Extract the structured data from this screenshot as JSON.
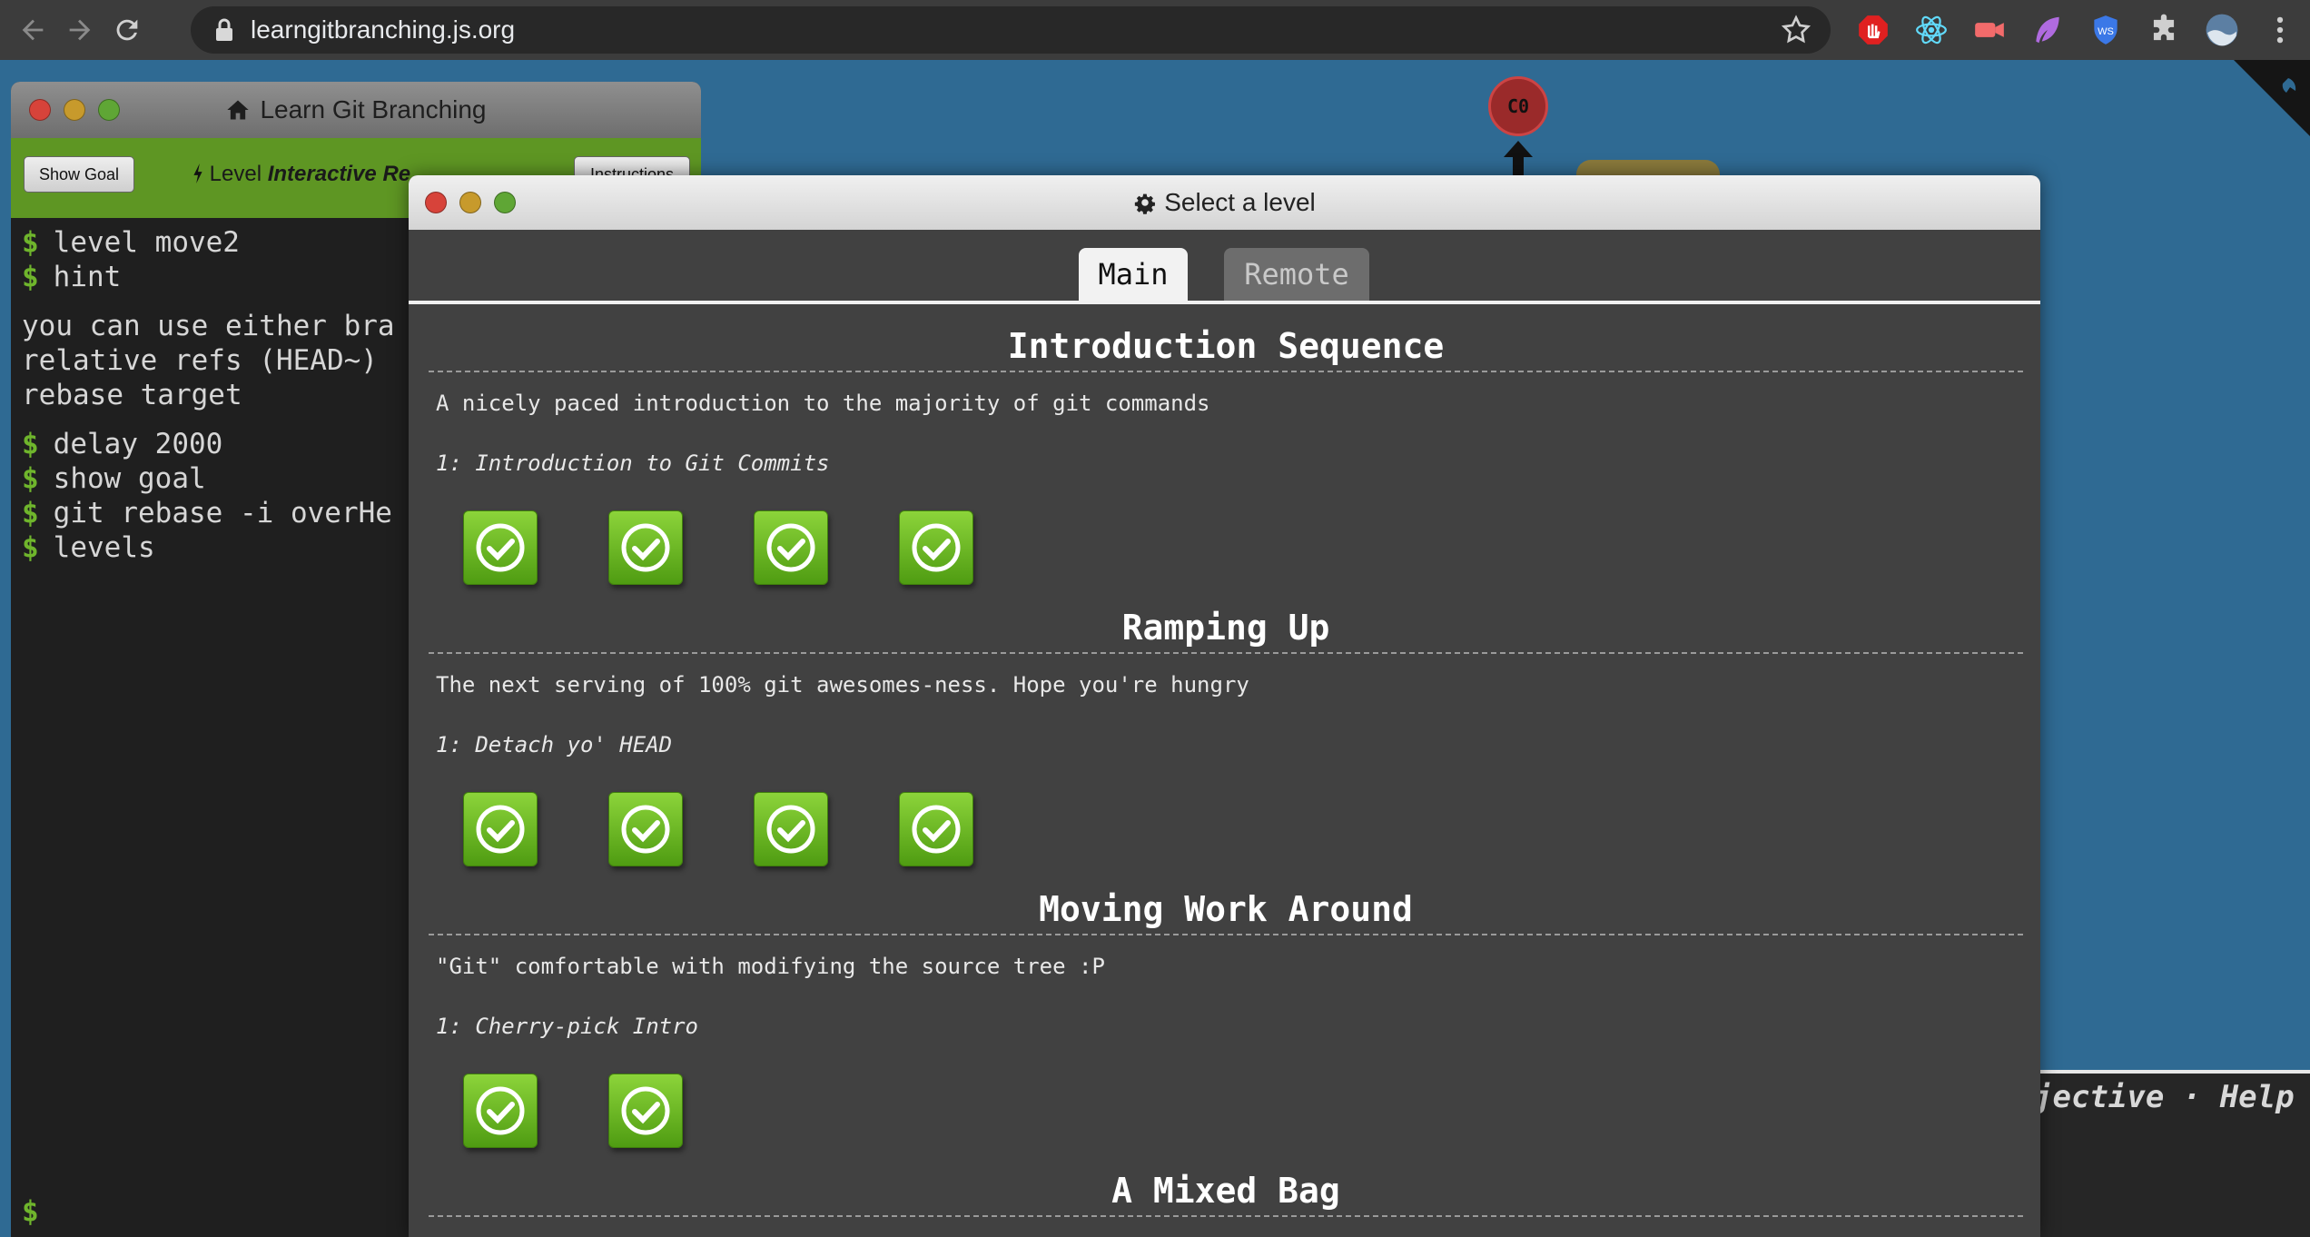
{
  "browser": {
    "url": "learngitbranching.js.org",
    "nav": {
      "back_icon": "back-arrow-icon",
      "forward_icon": "forward-arrow-icon",
      "reload_icon": "reload-icon"
    },
    "extensions": [
      "adblock-icon",
      "react-devtools-icon",
      "video-extension-icon",
      "feather-icon",
      "shield-icon",
      "puzzle-icon",
      "profile-avatar",
      "more-menu-icon"
    ]
  },
  "graph": {
    "commit_label": "C0"
  },
  "help_bar": {
    "text": "jective · Help"
  },
  "terminal": {
    "title": "Learn Git Branching",
    "show_goal": "Show Goal",
    "level_prefix": "Level",
    "level_name": "Interactive Re",
    "instructions": "Instructions",
    "lines": [
      {
        "prompt": "$",
        "text": "level move2"
      },
      {
        "prompt": "$",
        "text": "hint"
      },
      {
        "prompt": "",
        "text": "you can use either bra"
      },
      {
        "prompt": "",
        "text": "relative refs (HEAD~)"
      },
      {
        "prompt": "",
        "text": "rebase target"
      },
      {
        "prompt": "$",
        "text": "delay 2000"
      },
      {
        "prompt": "$",
        "text": "show goal"
      },
      {
        "prompt": "$",
        "text": "git rebase -i overHe"
      },
      {
        "prompt": "$",
        "text": "levels"
      }
    ],
    "bottom_prompt": "$"
  },
  "modal": {
    "title": "Select a level",
    "tabs": [
      {
        "label": "Main",
        "active": true
      },
      {
        "label": "Remote",
        "active": false
      }
    ],
    "sequences": [
      {
        "title": "Introduction Sequence",
        "description": "A nicely paced introduction to the majority of git commands",
        "selected_level": "1: Introduction to Git Commits",
        "levels_completed": 4
      },
      {
        "title": "Ramping Up",
        "description": "The next serving of 100% git awesomes-ness. Hope you're hungry",
        "selected_level": "1: Detach yo' HEAD",
        "levels_completed": 4
      },
      {
        "title": "Moving Work Around",
        "description": "\"Git\" comfortable with modifying the source tree :P",
        "selected_level": "1: Cherry-pick Intro",
        "levels_completed": 2
      },
      {
        "title": "A Mixed Bag",
        "description": "",
        "selected_level": "",
        "levels_completed": 0
      }
    ]
  },
  "colors": {
    "accent_green": "#5e9623",
    "check_green": "#6ab82a",
    "background_blue": "#2f6a93"
  }
}
